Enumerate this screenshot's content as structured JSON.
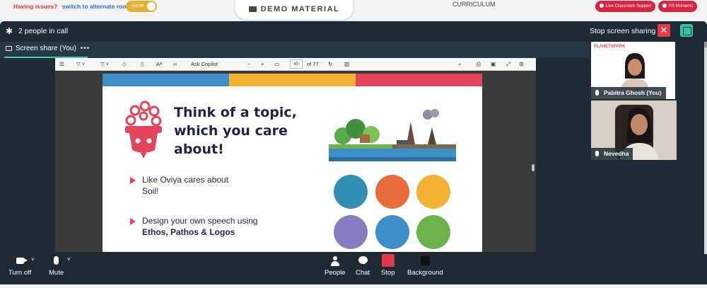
{
  "banner": {
    "issues_text": "Having issues?",
    "alternate_link": "switch to alternate room",
    "room_toggle": "ROOM",
    "demo_tab": "DEMO MATERIAL",
    "curriculum": "CURRICULUM",
    "live_support": "Live Classroom Support",
    "ps_moments": "PS Moments"
  },
  "call": {
    "people_in_call": "2 people in call",
    "stop_screen_sharing": "Stop screen sharing",
    "share_tab_label": "Screen share (You)",
    "share_tab_more": "•••"
  },
  "pdf": {
    "ask_copilot": "Ask Copilot",
    "current_page": "45",
    "total_pages": "of 77"
  },
  "slide": {
    "headline_line1": "Think of a topic,",
    "headline_line2": "which you care",
    "headline_line3": "about!",
    "bullet1_line1": "Like Oviya cares about",
    "bullet1_line2": "Soil!",
    "bullet2_line1": "Design your own speech using",
    "bullet2_line2": "Ethos, Pathos & Logos",
    "colors": {
      "blue": "#3e8ec8",
      "yellow": "#f2b234",
      "pink": "#e4445c",
      "navy": "#1f2547"
    }
  },
  "participants": [
    {
      "name": "Pabitra Ghosh (You)",
      "logo": "PLANETSPARK"
    },
    {
      "name": "Nevedha"
    }
  ],
  "controls": {
    "camera": "Turn off",
    "mic": "Mute",
    "people": "People",
    "chat": "Chat",
    "stop": "Stop",
    "background": "Background"
  }
}
